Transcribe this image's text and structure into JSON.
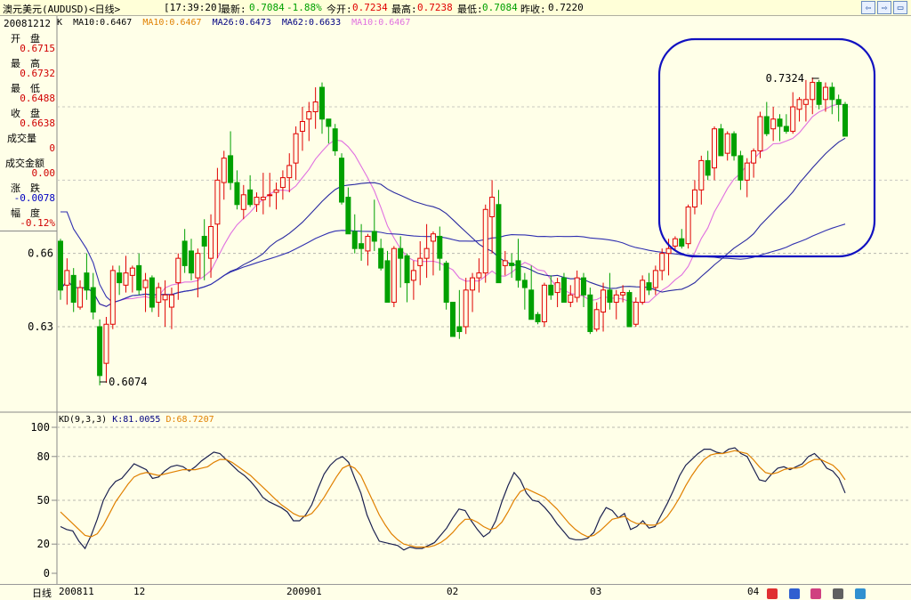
{
  "header": {
    "symbol": "澳元美元(AUDUSD)<日线>",
    "time": "[17:39:20]",
    "latest_label": "最新:",
    "latest_value": "0.7084",
    "change": "-1.88%",
    "open_label": "今开:",
    "open_value": "0.7234",
    "high_label": "最高:",
    "high_value": "0.7238",
    "low_label": "最低:",
    "low_value": "0.7084",
    "prev_label": "昨收:",
    "prev_value": "0.7220",
    "nav_prev": "⇦",
    "nav_next": "⇨",
    "colors": {
      "up": "#e00000",
      "down": "#00a000"
    }
  },
  "info_panel": {
    "date": "20081212",
    "rows": [
      {
        "label": "开　盘",
        "value": "0.6715",
        "tone": "red"
      },
      {
        "label": "最　高",
        "value": "0.6732",
        "tone": "red"
      },
      {
        "label": "最　低",
        "value": "0.6488",
        "tone": "red"
      },
      {
        "label": "收　盘",
        "value": "0.6638",
        "tone": "red"
      },
      {
        "label": "成交量",
        "value": "0",
        "tone": "red"
      },
      {
        "label": "成交金额",
        "value": "0.00",
        "tone": "red"
      },
      {
        "label": "涨　跌",
        "value": "-0.0078",
        "tone": "blue"
      },
      {
        "label": "幅　度",
        "value": "-0.12%",
        "tone": "red"
      }
    ]
  },
  "ma_legend": [
    {
      "text": "K",
      "color": "#000000"
    },
    {
      "text": "MA10:0.6467",
      "color": "#000000"
    },
    {
      "text": "MA10:0.6467",
      "color": "#e08000"
    },
    {
      "text": "MA26:0.6473",
      "color": "#000080"
    },
    {
      "text": "MA62:0.6633",
      "color": "#000080"
    },
    {
      "text": "MA10:0.6467",
      "color": "#e070e0"
    }
  ],
  "kd_legend": [
    {
      "text": "KD(9,3,3)",
      "color": "#000000"
    },
    {
      "text": "K:81.0055",
      "color": "#000080"
    },
    {
      "text": "D:68.7207",
      "color": "#e08000"
    }
  ],
  "annotations": {
    "high_label": "0.7324",
    "low_label": "0.6074"
  },
  "bottom": {
    "caption": "日线",
    "xticks": [
      "200811",
      "12",
      "200901",
      "02",
      "03",
      "04"
    ]
  },
  "chart_data": [
    {
      "type": "candlestick",
      "title": "澳元美元(AUDUSD)<日线>",
      "ylim": [
        0.6074,
        0.7324
      ],
      "ytick_labels": [
        "0.63",
        "0.66"
      ],
      "yticks": [
        0.63,
        0.66
      ],
      "grid": true,
      "candles": [
        [
          0.665,
          0.666,
          0.641,
          0.645
        ],
        [
          0.647,
          0.658,
          0.639,
          0.653
        ],
        [
          0.651,
          0.654,
          0.636,
          0.64
        ],
        [
          0.638,
          0.649,
          0.637,
          0.646
        ],
        [
          0.652,
          0.66,
          0.641,
          0.645
        ],
        [
          0.646,
          0.652,
          0.633,
          0.636
        ],
        [
          0.63,
          0.633,
          0.606,
          0.61
        ],
        [
          0.615,
          0.634,
          0.607,
          0.631
        ],
        [
          0.631,
          0.655,
          0.629,
          0.653
        ],
        [
          0.652,
          0.655,
          0.643,
          0.648
        ],
        [
          0.647,
          0.659,
          0.644,
          0.652
        ],
        [
          0.651,
          0.655,
          0.644,
          0.654
        ],
        [
          0.655,
          0.66,
          0.643,
          0.645
        ],
        [
          0.646,
          0.652,
          0.636,
          0.649
        ],
        [
          0.65,
          0.651,
          0.636,
          0.638
        ],
        [
          0.64,
          0.648,
          0.634,
          0.646
        ],
        [
          0.641,
          0.649,
          0.63,
          0.643
        ],
        [
          0.638,
          0.646,
          0.629,
          0.643
        ],
        [
          0.648,
          0.66,
          0.641,
          0.658
        ],
        [
          0.665,
          0.67,
          0.652,
          0.655
        ],
        [
          0.661,
          0.666,
          0.649,
          0.652
        ],
        [
          0.65,
          0.662,
          0.642,
          0.66
        ],
        [
          0.667,
          0.674,
          0.649,
          0.663
        ],
        [
          0.658,
          0.676,
          0.65,
          0.671
        ],
        [
          0.672,
          0.695,
          0.658,
          0.69
        ],
        [
          0.689,
          0.702,
          0.682,
          0.699
        ],
        [
          0.7,
          0.71,
          0.686,
          0.689
        ],
        [
          0.689,
          0.694,
          0.678,
          0.68
        ],
        [
          0.678,
          0.688,
          0.674,
          0.684
        ],
        [
          0.686,
          0.692,
          0.679,
          0.68
        ],
        [
          0.68,
          0.685,
          0.677,
          0.683
        ],
        [
          0.682,
          0.693,
          0.676,
          0.683
        ],
        [
          0.684,
          0.693,
          0.679,
          0.684
        ],
        [
          0.685,
          0.689,
          0.678,
          0.686
        ],
        [
          0.687,
          0.694,
          0.682,
          0.691
        ],
        [
          0.691,
          0.701,
          0.685,
          0.696
        ],
        [
          0.697,
          0.712,
          0.69,
          0.709
        ],
        [
          0.71,
          0.72,
          0.702,
          0.714
        ],
        [
          0.715,
          0.722,
          0.706,
          0.718
        ],
        [
          0.718,
          0.728,
          0.711,
          0.722
        ],
        [
          0.728,
          0.73,
          0.709,
          0.715
        ],
        [
          0.715,
          0.714,
          0.705,
          0.712
        ],
        [
          0.711,
          0.713,
          0.7,
          0.702
        ],
        [
          0.699,
          0.701,
          0.68,
          0.681
        ],
        [
          0.683,
          0.687,
          0.668,
          0.668
        ],
        [
          0.669,
          0.676,
          0.66,
          0.662
        ],
        [
          0.664,
          0.672,
          0.657,
          0.662
        ],
        [
          0.661,
          0.668,
          0.655,
          0.667
        ],
        [
          0.669,
          0.682,
          0.661,
          0.665
        ],
        [
          0.662,
          0.666,
          0.653,
          0.654
        ],
        [
          0.657,
          0.661,
          0.64,
          0.64
        ],
        [
          0.64,
          0.663,
          0.638,
          0.662
        ],
        [
          0.662,
          0.667,
          0.646,
          0.658
        ],
        [
          0.659,
          0.66,
          0.64,
          0.648
        ],
        [
          0.649,
          0.657,
          0.641,
          0.653
        ],
        [
          0.655,
          0.665,
          0.647,
          0.658
        ],
        [
          0.658,
          0.672,
          0.65,
          0.662
        ],
        [
          0.665,
          0.669,
          0.651,
          0.668
        ],
        [
          0.667,
          0.671,
          0.653,
          0.658
        ],
        [
          0.656,
          0.657,
          0.637,
          0.64
        ],
        [
          0.64,
          0.64,
          0.63,
          0.626
        ],
        [
          0.63,
          0.645,
          0.625,
          0.628
        ],
        [
          0.63,
          0.65,
          0.627,
          0.645
        ],
        [
          0.645,
          0.652,
          0.636,
          0.65
        ],
        [
          0.65,
          0.658,
          0.644,
          0.652
        ],
        [
          0.652,
          0.68,
          0.648,
          0.678
        ],
        [
          0.675,
          0.69,
          0.66,
          0.683
        ],
        [
          0.68,
          0.686,
          0.65,
          0.648
        ],
        [
          0.655,
          0.661,
          0.651,
          0.657
        ],
        [
          0.656,
          0.66,
          0.65,
          0.655
        ],
        [
          0.657,
          0.666,
          0.646,
          0.649
        ],
        [
          0.649,
          0.652,
          0.637,
          0.646
        ],
        [
          0.645,
          0.655,
          0.633,
          0.633
        ],
        [
          0.635,
          0.636,
          0.631,
          0.632
        ],
        [
          0.632,
          0.648,
          0.63,
          0.647
        ],
        [
          0.647,
          0.651,
          0.641,
          0.643
        ],
        [
          0.644,
          0.65,
          0.638,
          0.648
        ],
        [
          0.65,
          0.652,
          0.64,
          0.64
        ],
        [
          0.64,
          0.647,
          0.638,
          0.643
        ],
        [
          0.642,
          0.653,
          0.64,
          0.65
        ],
        [
          0.65,
          0.652,
          0.638,
          0.643
        ],
        [
          0.643,
          0.646,
          0.627,
          0.628
        ],
        [
          0.629,
          0.64,
          0.628,
          0.637
        ],
        [
          0.636,
          0.648,
          0.628,
          0.645
        ],
        [
          0.645,
          0.652,
          0.637,
          0.64
        ],
        [
          0.64,
          0.645,
          0.633,
          0.643
        ],
        [
          0.643,
          0.647,
          0.64,
          0.644
        ],
        [
          0.644,
          0.645,
          0.63,
          0.63
        ],
        [
          0.631,
          0.642,
          0.63,
          0.64
        ],
        [
          0.64,
          0.651,
          0.639,
          0.649
        ],
        [
          0.648,
          0.652,
          0.643,
          0.645
        ],
        [
          0.646,
          0.655,
          0.643,
          0.653
        ],
        [
          0.653,
          0.662,
          0.649,
          0.66
        ],
        [
          0.66,
          0.666,
          0.651,
          0.662
        ],
        [
          0.663,
          0.667,
          0.661,
          0.666
        ],
        [
          0.666,
          0.67,
          0.662,
          0.663
        ],
        [
          0.664,
          0.68,
          0.662,
          0.679
        ],
        [
          0.679,
          0.69,
          0.676,
          0.686
        ],
        [
          0.686,
          0.7,
          0.68,
          0.698
        ],
        [
          0.698,
          0.702,
          0.69,
          0.692
        ],
        [
          0.695,
          0.712,
          0.69,
          0.711
        ],
        [
          0.711,
          0.713,
          0.7,
          0.7
        ],
        [
          0.701,
          0.71,
          0.698,
          0.709
        ],
        [
          0.709,
          0.71,
          0.698,
          0.7
        ],
        [
          0.7,
          0.702,
          0.686,
          0.69
        ],
        [
          0.69,
          0.699,
          0.683,
          0.697
        ],
        [
          0.697,
          0.703,
          0.691,
          0.702
        ],
        [
          0.702,
          0.718,
          0.699,
          0.716
        ],
        [
          0.716,
          0.722,
          0.708,
          0.709
        ],
        [
          0.711,
          0.72,
          0.706,
          0.715
        ],
        [
          0.715,
          0.717,
          0.706,
          0.712
        ],
        [
          0.712,
          0.717,
          0.709,
          0.71
        ],
        [
          0.71,
          0.726,
          0.709,
          0.72
        ],
        [
          0.719,
          0.724,
          0.714,
          0.723
        ],
        [
          0.721,
          0.731,
          0.714,
          0.723
        ],
        [
          0.723,
          0.732,
          0.717,
          0.73
        ],
        [
          0.73,
          0.731,
          0.719,
          0.721
        ],
        [
          0.723,
          0.73,
          0.718,
          0.728
        ],
        [
          0.728,
          0.73,
          0.717,
          0.723
        ],
        [
          0.723,
          0.725,
          0.714,
          0.721
        ],
        [
          0.721,
          0.722,
          0.708,
          0.708
        ]
      ]
    },
    {
      "type": "line",
      "title": "KD(9,3,3)",
      "ylim": [
        0,
        100
      ],
      "ytick_labels": [
        "0",
        "20",
        "50",
        "80",
        "100"
      ],
      "yticks": [
        0,
        20,
        50,
        80,
        100
      ],
      "series": [
        {
          "name": "K",
          "color": "#1a2050",
          "values": [
            32,
            30,
            29,
            22,
            17,
            26,
            37,
            50,
            58,
            63,
            65,
            70,
            75,
            73,
            71,
            65,
            66,
            70,
            73,
            74,
            73,
            70,
            73,
            77,
            80,
            83,
            82,
            78,
            74,
            70,
            67,
            63,
            58,
            52,
            49,
            47,
            45,
            42,
            36,
            36,
            40,
            47,
            58,
            68,
            74,
            78,
            80,
            76,
            65,
            55,
            40,
            30,
            22,
            21,
            20,
            19,
            16,
            18,
            17,
            17,
            19,
            21,
            26,
            31,
            38,
            44,
            43,
            36,
            30,
            25,
            28,
            36,
            49,
            60,
            69,
            64,
            55,
            50,
            49,
            45,
            40,
            34,
            29,
            24,
            23,
            23,
            24,
            28,
            38,
            45,
            43,
            38,
            41,
            30,
            32,
            36,
            31,
            32,
            40,
            48,
            57,
            67,
            74,
            78,
            82,
            85,
            85,
            83,
            82,
            85,
            86,
            82,
            80,
            72,
            64,
            63,
            68,
            72,
            73,
            71,
            73,
            75,
            80,
            82,
            78,
            72,
            70,
            65,
            55
          ]
        },
        {
          "name": "D",
          "color": "#e08000",
          "values": [
            42,
            38,
            34,
            30,
            26,
            25,
            27,
            33,
            41,
            49,
            55,
            61,
            66,
            68,
            69,
            68,
            67,
            68,
            69,
            70,
            71,
            71,
            71,
            72,
            73,
            76,
            78,
            78,
            76,
            73,
            70,
            67,
            63,
            59,
            55,
            51,
            47,
            44,
            41,
            39,
            39,
            41,
            46,
            52,
            59,
            66,
            72,
            74,
            72,
            67,
            58,
            49,
            40,
            33,
            27,
            23,
            20,
            19,
            18,
            18,
            18,
            19,
            21,
            24,
            28,
            33,
            37,
            37,
            35,
            32,
            30,
            31,
            35,
            42,
            50,
            56,
            58,
            56,
            54,
            52,
            48,
            44,
            39,
            34,
            30,
            27,
            25,
            26,
            29,
            33,
            37,
            38,
            39,
            36,
            34,
            34,
            33,
            33,
            35,
            39,
            45,
            52,
            60,
            67,
            73,
            78,
            81,
            82,
            82,
            83,
            84,
            83,
            82,
            78,
            73,
            69,
            68,
            69,
            71,
            72,
            72,
            73,
            76,
            78,
            78,
            76,
            74,
            70,
            64
          ]
        }
      ]
    }
  ]
}
